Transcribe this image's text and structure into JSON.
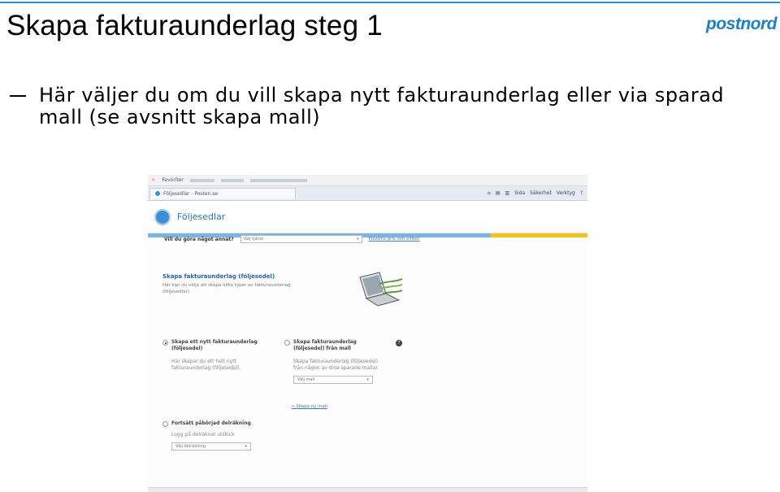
{
  "slide": {
    "title": "Skapa fakturaunderlag steg 1",
    "logo": "postnord",
    "bullet": "Här väljer du om du vill skapa nytt fakturaunderlag eller via sparad mall (se avsnitt skapa mall)"
  },
  "browser": {
    "favorites_label": "Favoriter",
    "tab_label": "Följesedlar - Posten.se",
    "toolbar": [
      "Sida",
      "Säkerhet",
      "Verktyg"
    ]
  },
  "page": {
    "header_title": "Följesedlar",
    "choose_label": "Vill du göra något annat?",
    "choose_select": "Välj tjänst",
    "terms_link": "Postens pris och villkor",
    "section_title": "Skapa fakturaunderlag (följesedel)",
    "section_desc": "Här kan du välja att skapa olika typer av fakturaunderlag (följesedlar).",
    "option_new_title": "Skapa ett nytt fakturaunderlag (följesedel)",
    "option_new_desc": "Här skapar du ett helt nytt fakturaunderlag (följesedel).",
    "option_template_title": "Skapa fakturaunderlag (följesedel) från mall",
    "option_template_desc": "Skapa fakturaunderlag (följesedel) från någon av dina sparade mallar.",
    "template_select": "Välj mall",
    "new_template_link": "» Skapa ny mall",
    "option_continue_title": "Fortsätt påbörjad delräkning",
    "option_continue_desc": "Logg på delräknat utskick",
    "continue_select": "Välj delräkning"
  },
  "colors": {
    "accent_blue": "#2b8fd0",
    "logo_blue": "#1e7fc7",
    "stripe_yellow": "#f4c21c"
  }
}
